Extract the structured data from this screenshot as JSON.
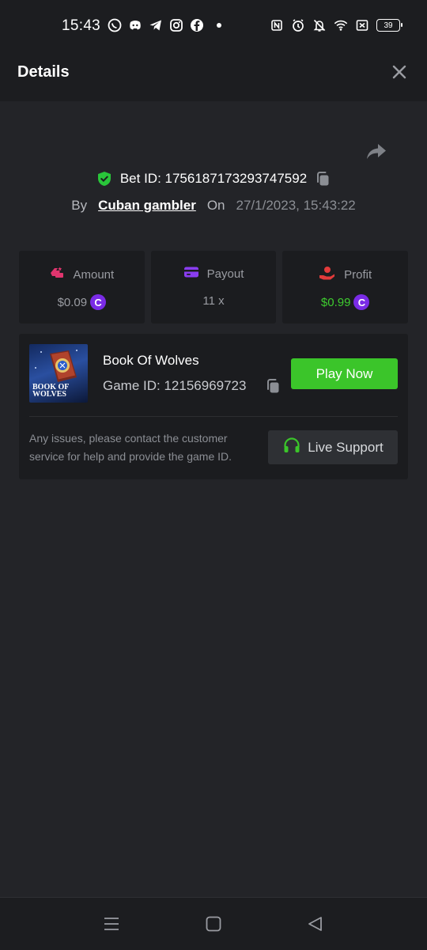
{
  "status_bar": {
    "time": "15:43",
    "battery": "39",
    "left_icons": [
      "whatsapp-icon",
      "discord-icon",
      "telegram-icon",
      "instagram-icon",
      "facebook-icon"
    ],
    "right_icons": [
      "nfc-icon",
      "alarm-icon",
      "mute-icon",
      "wifi-icon",
      "sim-off-icon",
      "battery-icon"
    ]
  },
  "header": {
    "title": "Details"
  },
  "bet": {
    "id_label": "Bet ID: 1756187173293747592",
    "by_label": "By",
    "user": "Cuban gambler",
    "on_label": "On",
    "date": "27/1/2023, 15:43:22"
  },
  "stats": {
    "amount": {
      "label": "Amount",
      "value": "$0.09"
    },
    "payout": {
      "label": "Payout",
      "value": "11 x"
    },
    "profit": {
      "label": "Profit",
      "value": "$0.99"
    }
  },
  "game": {
    "name": "Book Of Wolves",
    "id_label": "Game ID: 12156969723",
    "thumb_title_line1": "BOOK OF",
    "thumb_title_line2": "WOLVES",
    "play_label": "Play Now",
    "issues_text": "Any issues, please contact the customer service for help and provide the game ID.",
    "support_label": "Live Support"
  },
  "colors": {
    "accent_green": "#3bc52a",
    "coin_purple": "#7a2be6",
    "shield_green": "#29c53a",
    "amount_icon_pink": "#e0356e",
    "payout_icon_purple": "#8a3df0",
    "profit_icon_red": "#e33b3b"
  }
}
